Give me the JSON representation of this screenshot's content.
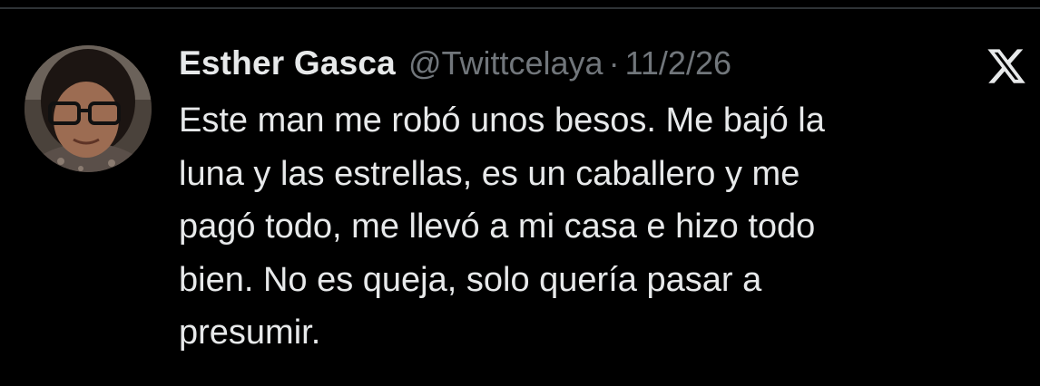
{
  "tweet": {
    "author_name": "Esther Gasca",
    "handle": "@Twittcelaya",
    "separator": "·",
    "date": "11/2/26",
    "text": "Este man me robó unos besos. Me bajó la\nluna y las estrellas, es un caballero y me\npagó todo, me llevó a mi casa e hizo todo\nbien. No es queja, solo quería pasar a\npresumir."
  },
  "icons": {
    "brand": "x-logo-icon",
    "avatar": "profile-photo"
  },
  "colors": {
    "background": "#000000",
    "primary_text": "#e7e9ea",
    "secondary_text": "#71767b"
  }
}
